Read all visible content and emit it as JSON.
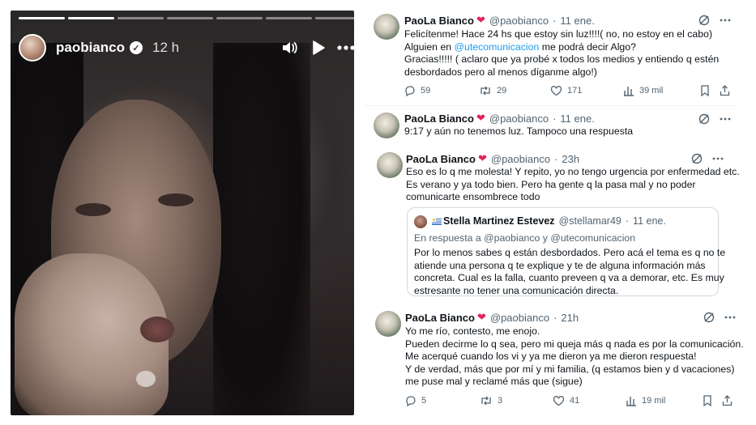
{
  "story": {
    "username": "paobianco",
    "time": "12 h",
    "progress_segments": 7,
    "progress_completed": 2
  },
  "tweets": [
    {
      "author": "PaoLa Bianco",
      "handle": "@paobianco",
      "dot": "·",
      "time": "11 ene.",
      "lines": [
        "Felicítenme! Hace 24 hs que estoy sin luz!!!!( no, no estoy en el cabo)",
        "Gracias!!!!! ( aclaro que  ya probé x todos los medios y entiendo q estén",
        "desbordados pero al menos díganme algo!)"
      ],
      "line2_prefix": "Alguien en ",
      "mention": "@utecomunicacion",
      "line2_suffix": " me podrá decir Algo?",
      "replies": "59",
      "retweets": "29",
      "likes": "171",
      "views": "39 mil"
    },
    {
      "author": "PaoLa Bianco",
      "handle": "@paobianco",
      "dot": "·",
      "time": "11 ene.",
      "lines": [
        "9:17 y aún no tenemos luz. Tampoco una respuesta"
      ]
    },
    {
      "author": "PaoLa Bianco",
      "handle": "@paobianco",
      "dot": "·",
      "time": "23h",
      "lines": [
        "Eso es lo q me molesta! Y repito, yo no tengo urgencia por enfermedad etc.",
        "Es verano y ya todo bien. Pero ha gente q la pasa mal y no poder",
        "comunicarte ensombrece todo"
      ],
      "quote": {
        "author": "Stella Martinez Estevez",
        "handle": "@stellamar49",
        "dot": "·",
        "time": "11 ene.",
        "reply_to": "En respuesta a @paobianco y @utecomunicacion",
        "lines": [
          "Por lo menos sabes q están desbordados.  Pero acá el tema  es q no te",
          "atiende una persona q te explique y te de alguna información más",
          "concreta. Cual es la falla, cuanto preveen q va a demorar, etc. Es muy",
          "estresante no tener una comunicación directa."
        ]
      }
    },
    {
      "author": "PaoLa Bianco",
      "handle": "@paobianco",
      "dot": "·",
      "time": "21h",
      "lines": [
        "Yo me río, contesto, me enojo.",
        "Pueden decirme lo q sea, pero mi queja más q nada es por la comunicación.",
        "Me acerqué cuando los vi y ya me dieron ya me dieron respuesta!",
        "Y de verdad, más que por mí y mi familia, (q estamos bien y d vacaciones)",
        "me puse mal y reclamé más que (sigue)"
      ],
      "replies": "5",
      "retweets": "3",
      "likes": "41",
      "views": "19 mil"
    }
  ],
  "colors": {
    "text": "#0f1419",
    "secondary": "#536471",
    "link": "#1d9bf0",
    "heart": "#e0245e",
    "border": "#cfd9de"
  },
  "icons": [
    "verified-icon",
    "mute-icon",
    "play-icon",
    "more-icon",
    "grok-icon",
    "reply-icon",
    "retweet-icon",
    "like-icon",
    "views-icon",
    "bookmark-icon",
    "share-icon",
    "heart-emoji-icon"
  ]
}
